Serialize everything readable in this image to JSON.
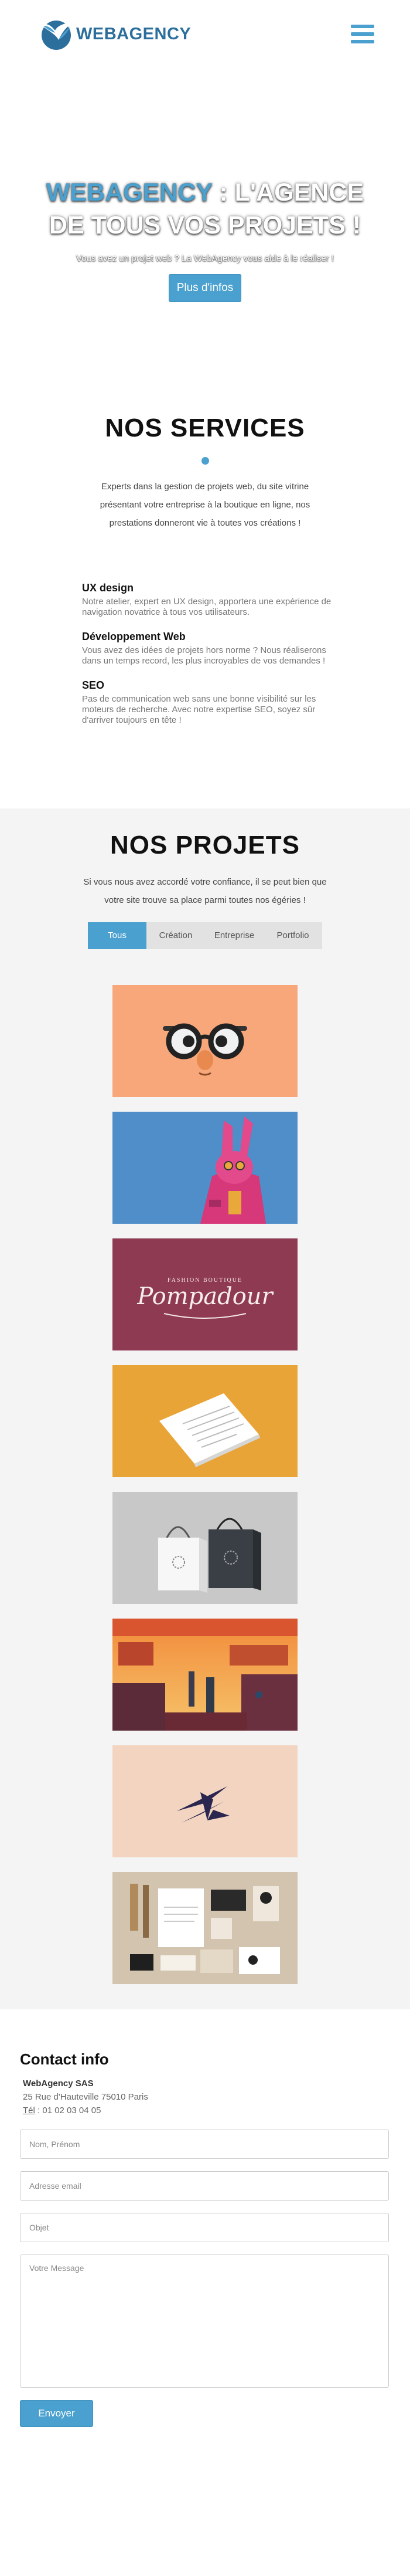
{
  "brand": {
    "name": "WEBAGENCY",
    "logo_icon": "bird-logo-icon"
  },
  "header": {
    "menu_icon": "hamburger-menu-icon"
  },
  "hero": {
    "title_brand": "WEBAGENCY",
    "title_rest_1": " : L'AGENCE",
    "title_line_2": "DE TOUS VOS PROJETS !",
    "subtitle": "Vous avez un projet web ? La WebAgency vous aide à le réaliser !",
    "button": "Plus d'infos"
  },
  "services": {
    "title": "NOS SERVICES",
    "intro": "Experts dans la gestion de projets web, du site vitrine présentant votre entreprise à la boutique en ligne, nos prestations donneront vie à toutes vos créations !",
    "items": [
      {
        "title": "UX design",
        "desc": "Notre atelier, expert en UX design, apportera une expérience de navigation novatrice à tous vos utilisateurs."
      },
      {
        "title": "Développement Web",
        "desc": "Vous avez des idées de projets hors norme ? Nous réaliserons dans un temps record, les plus incroyables de vos demandes !"
      },
      {
        "title": "SEO",
        "desc": "Pas de communication web sans une bonne visibilité sur les moteurs de recherche. Avec notre expertise SEO, soyez sûr d'arriver toujours en tête !"
      }
    ]
  },
  "projets": {
    "title": "NOS PROJETS",
    "intro": "Si vous nous avez accordé votre confiance, il se peut bien que votre site trouve sa place parmi toutes nos égéries !",
    "tabs": [
      "Tous",
      "Création",
      "Entreprise",
      "Portfolio"
    ],
    "active_tab": "Tous",
    "project_images": [
      "glasses-illustration-image",
      "pink-rabbit-illustration-image",
      "pompadour-logo-image",
      "paper-mockup-image",
      "shopping-bags-image",
      "city-sunset-illustration-image",
      "bird-logo-image",
      "stationery-mockup-image"
    ],
    "pompadour_text": "Pompadour",
    "pompadour_small": "FASHION BOUTIQUE"
  },
  "contact": {
    "title": "Contact info",
    "company": "WebAgency SAS",
    "address": "25 Rue d'Hauteville 75010 Paris",
    "tel_label": "Tél",
    "tel_value": " : 01 02 03 04 05",
    "placeholders": {
      "name": "Nom, Prénom",
      "email": "Adresse email",
      "subject": "Objet",
      "message": "Votre Message"
    },
    "submit": "Envoyer"
  },
  "colors": {
    "accent": "#4aa0cf",
    "brand_dark": "#2c6f9c",
    "section_bg": "#f4f4f4"
  }
}
